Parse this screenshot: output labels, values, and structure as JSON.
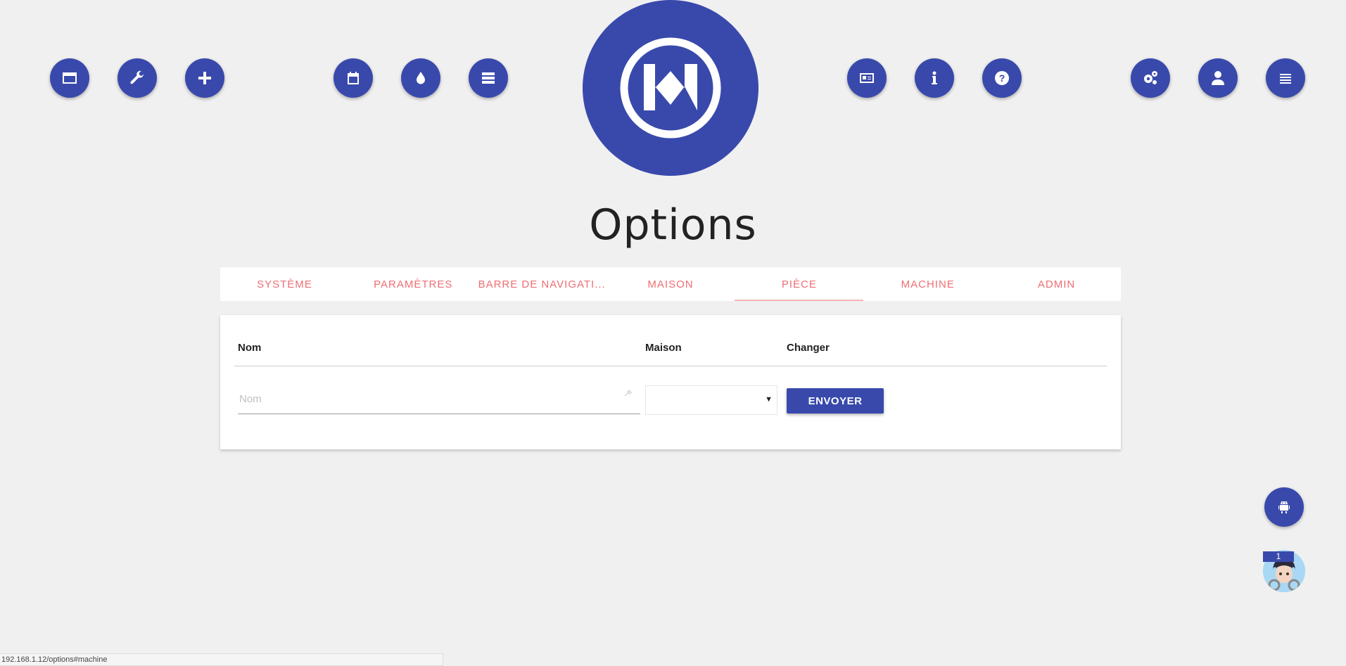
{
  "nav": {
    "left_icons": [
      "window-icon",
      "wrench-icon",
      "plus-icon",
      "calendar-icon",
      "drop-icon",
      "server-icon"
    ],
    "right_icons": [
      "id-card-icon",
      "info-icon",
      "question-icon",
      "cogs-icon",
      "user-icon",
      "menu-icon"
    ]
  },
  "logo": {
    "icon": "logo-icon"
  },
  "page": {
    "title": "Options"
  },
  "tabs": [
    {
      "label": "Système",
      "active": false
    },
    {
      "label": "Paramètres",
      "active": false
    },
    {
      "label": "Barre de navigati...",
      "active": false
    },
    {
      "label": "Maison",
      "active": false
    },
    {
      "label": "Pièce",
      "active": true
    },
    {
      "label": "Machine",
      "active": false
    },
    {
      "label": "Admin",
      "active": false
    }
  ],
  "table": {
    "headers": {
      "nom": "Nom",
      "maison": "Maison",
      "changer": "Changer"
    },
    "nom_input": {
      "value": "",
      "placeholder": "Nom"
    },
    "maison_select": {
      "selected": ""
    },
    "submit_label": "Envoyer"
  },
  "floating": {
    "robot_icon": "android-icon",
    "badge_count": "1"
  },
  "status_bar": {
    "url": "192.168.1.12/options#machine"
  },
  "colors": {
    "primary": "#3949ab",
    "tab_text": "#ee6e73",
    "background": "#f0f0f0"
  }
}
